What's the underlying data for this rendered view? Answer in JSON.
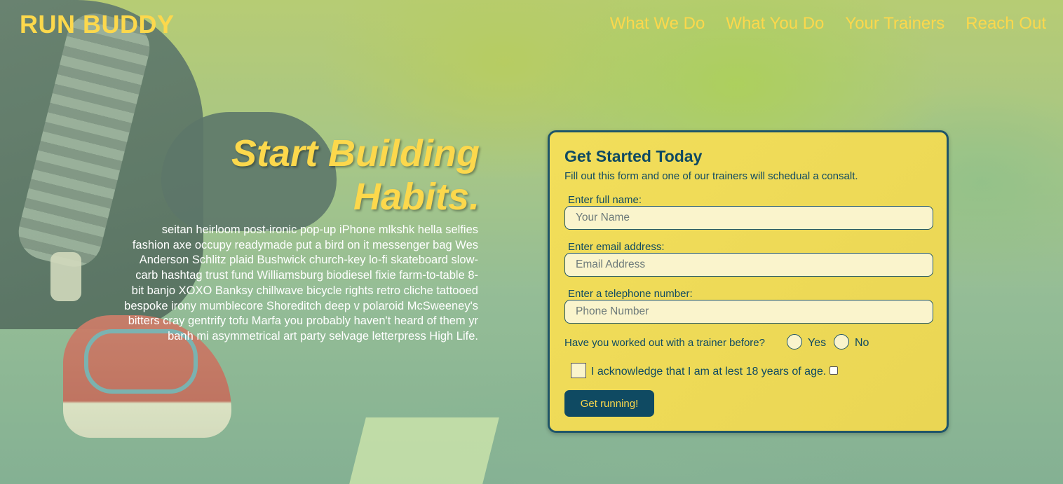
{
  "header": {
    "brand": "RUN BUDDY",
    "nav": [
      {
        "label": "What We Do"
      },
      {
        "label": "What You Do"
      },
      {
        "label": "Your Trainers"
      },
      {
        "label": "Reach Out"
      }
    ]
  },
  "hero": {
    "title_line1": "Start Building",
    "title_line2": "Habits.",
    "text": "seitan heirloom post-ironic pop-up iPhone mlkshk hella selfies fashion axe occupy readymade put a bird on it messenger bag Wes Anderson Schlitz plaid Bushwick church-key lo-fi skateboard slow-carb hashtag trust fund Williamsburg biodiesel fixie farm-to-table 8-bit banjo XOXO Banksy chillwave bicycle rights retro cliche tattooed bespoke irony mumblecore Shoreditch deep v polaroid McSweeney's bitters cray gentrify tofu Marfa you probably haven't heard of them yr banh mi asymmetrical art party selvage letterpress High Life."
  },
  "form": {
    "title": "Get Started Today",
    "subtitle": "Fill out this form and one of our trainers will schedual a consalt.",
    "name_label": "Enter full name:",
    "name_placeholder": "Your Name",
    "name_value": "",
    "email_label": "Enter email address:",
    "email_placeholder": "Email Address",
    "email_value": "",
    "phone_label": "Enter a telephone number:",
    "phone_placeholder": "Phone Number",
    "phone_value": "",
    "question": "Have you worked out with a trainer before?",
    "option_yes": "Yes",
    "option_no": "No",
    "acknowledge": "I acknowledge that I am at lest 18 years of age.",
    "submit_label": "Get running!"
  },
  "colors": {
    "accent_yellow": "#fcd84c",
    "dark_teal": "#0f4a62",
    "card_bg": "#f2de5a"
  }
}
